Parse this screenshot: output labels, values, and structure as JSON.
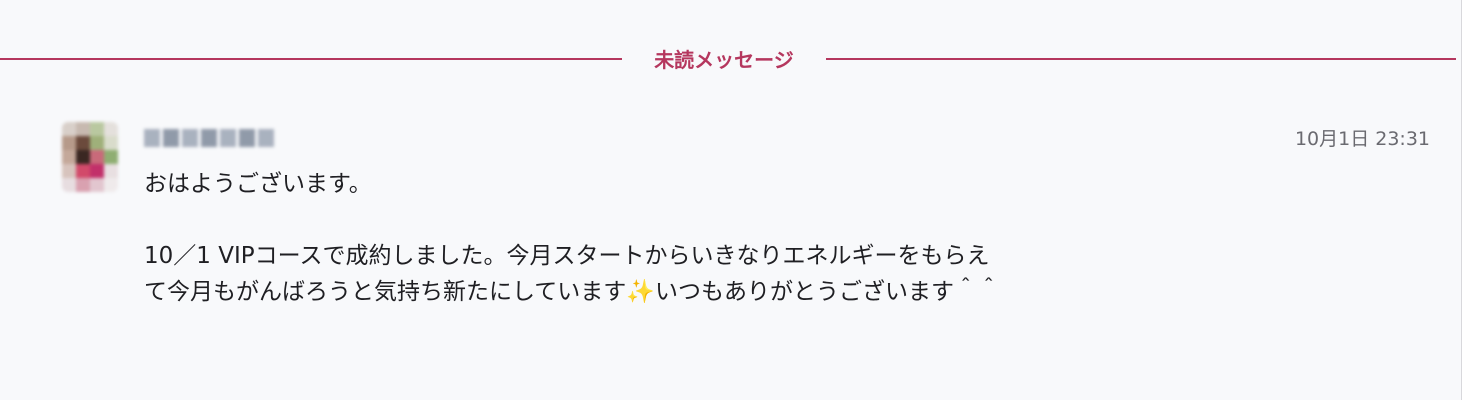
{
  "divider": {
    "label": "未読メッセージ"
  },
  "message": {
    "sender_name_redacted": "",
    "timestamp": "10月1日 23:31",
    "paragraph1": "おはようございます。",
    "paragraph2_line1": "10／1 VIPコースで成約しました。今月スタートからいきなりエネルギーをもらえ",
    "paragraph2_line2_a": "て今月もがんばろうと気持ち新たにしています",
    "sparkle_emoji": "✨",
    "paragraph2_line2_b": "いつもありがとうございます＾＾"
  },
  "colors": {
    "accent": "#b5375e",
    "background": "#f8f9fb",
    "text": "#1f1f23",
    "muted": "#6a6a70"
  },
  "icons": {
    "avatar": "user-avatar-pixelated",
    "sparkle": "sparkles-emoji"
  }
}
